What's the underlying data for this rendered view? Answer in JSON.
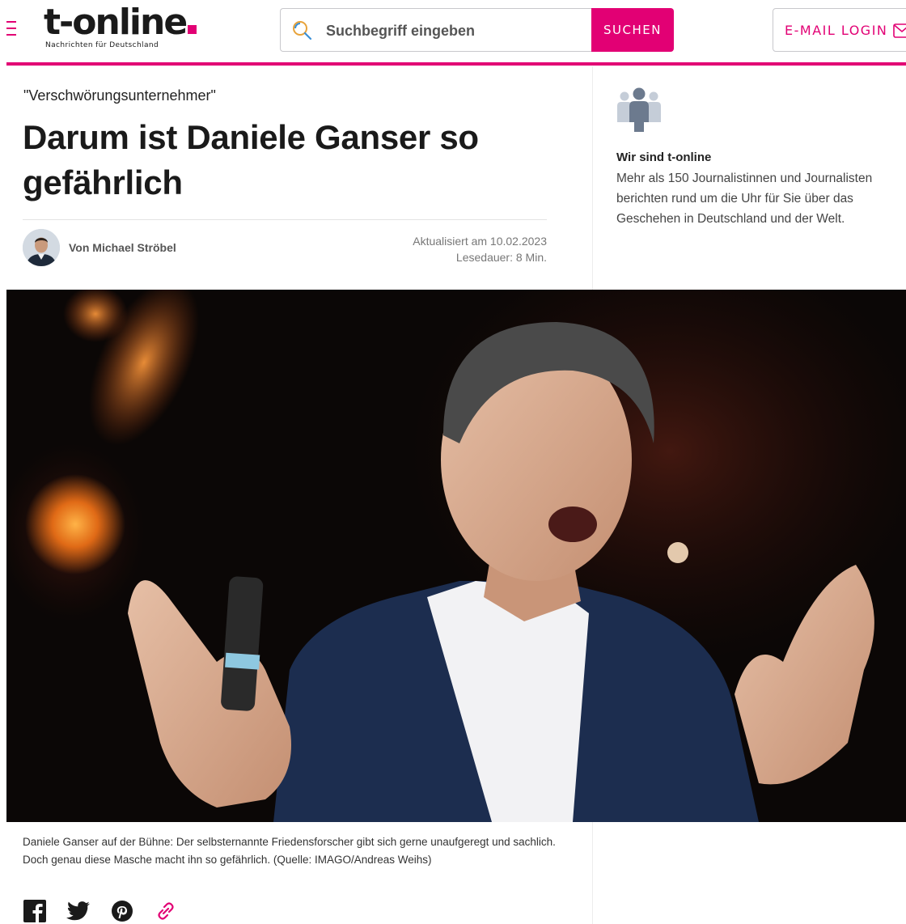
{
  "header": {
    "logo_text": "t-online",
    "tagline": "Nachrichten für Deutschland",
    "search_placeholder": "Suchbegriff eingeben",
    "search_button": "SUCHEN",
    "email_login": "E-MAIL LOGIN"
  },
  "article": {
    "kicker": "\"Verschwörungsunternehmer\"",
    "headline": "Darum ist Daniele Ganser so gefährlich",
    "author": "Von Michael Ströbel",
    "updated": "Aktualisiert am 10.02.2023",
    "reading_time": "Lesedauer: 8 Min.",
    "caption": "Daniele Ganser auf der Bühne: Der selbsternannte Friedensforscher gibt sich gerne unaufgeregt und sachlich. Doch genau diese Masche macht ihn so gefährlich. (Quelle: IMAGO/Andreas Weihs)"
  },
  "sidebar": {
    "title": "Wir sind t-online",
    "text": "Mehr als 150 Journalistinnen und Journalisten berichten rund um die Uhr für Sie über das Geschehen in Deutschland und der Welt."
  },
  "share": {
    "icons": [
      "facebook-icon",
      "twitter-icon",
      "pinterest-icon",
      "link-icon"
    ]
  },
  "colors": {
    "brand": "#e20074",
    "text": "#1a1a1a"
  }
}
